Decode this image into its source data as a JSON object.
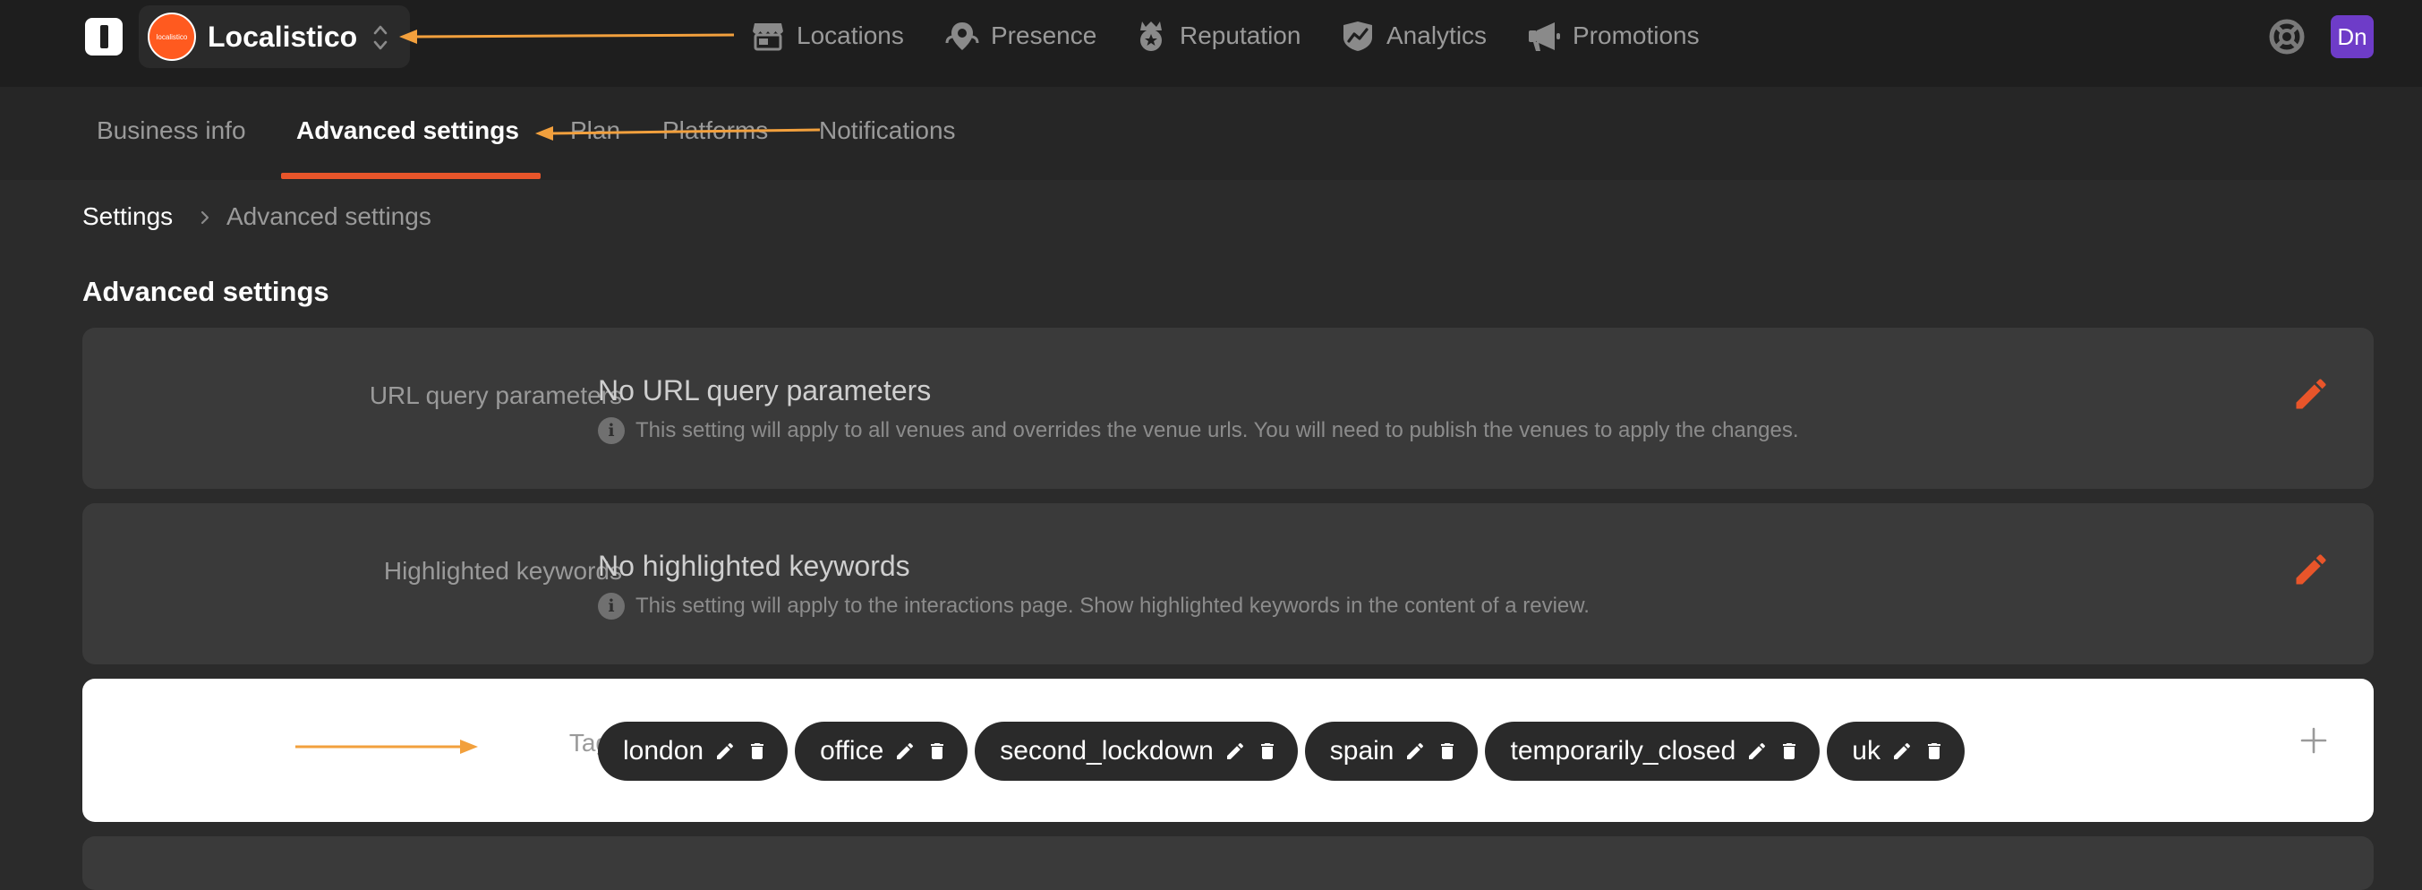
{
  "app": {
    "logo_icon": "localistico-logo-icon"
  },
  "business": {
    "name": "Localistico",
    "avatar_text": "localistico"
  },
  "nav": [
    {
      "label": "Locations",
      "icon": "store-icon"
    },
    {
      "label": "Presence",
      "icon": "location-pin-icon"
    },
    {
      "label": "Reputation",
      "icon": "badge-icon"
    },
    {
      "label": "Analytics",
      "icon": "chart-shield-icon"
    },
    {
      "label": "Promotions",
      "icon": "megaphone-icon"
    }
  ],
  "user": {
    "initials": "Dn"
  },
  "subnav": {
    "tabs": [
      {
        "label": "Business info",
        "active": false
      },
      {
        "label": "Advanced settings",
        "active": true
      },
      {
        "label": "Plan",
        "active": false
      },
      {
        "label": "Platforms",
        "active": false
      },
      {
        "label": "Notifications",
        "active": false
      }
    ]
  },
  "breadcrumb": {
    "root": "Settings",
    "current": "Advanced settings"
  },
  "page_title": "Advanced settings",
  "settings": {
    "url_params": {
      "label": "URL query parameters",
      "value": "No URL query parameters",
      "hint": "This setting will apply to all venues and overrides the venue urls. You will need to publish the venues to apply the changes."
    },
    "keywords": {
      "label": "Highlighted keywords",
      "value": "No highlighted keywords",
      "hint": "This setting will apply to the interactions page. Show highlighted keywords in the content of a review."
    },
    "tags": {
      "label": "Tags",
      "items": [
        "london",
        "office",
        "second_lockdown",
        "spain",
        "temporarily_closed",
        "uk"
      ]
    }
  },
  "colors": {
    "accent": "#e8552a",
    "annotation": "#f2a03d",
    "avatar_brand": "#ff5a1f",
    "user_avatar": "#6e3cc8"
  }
}
